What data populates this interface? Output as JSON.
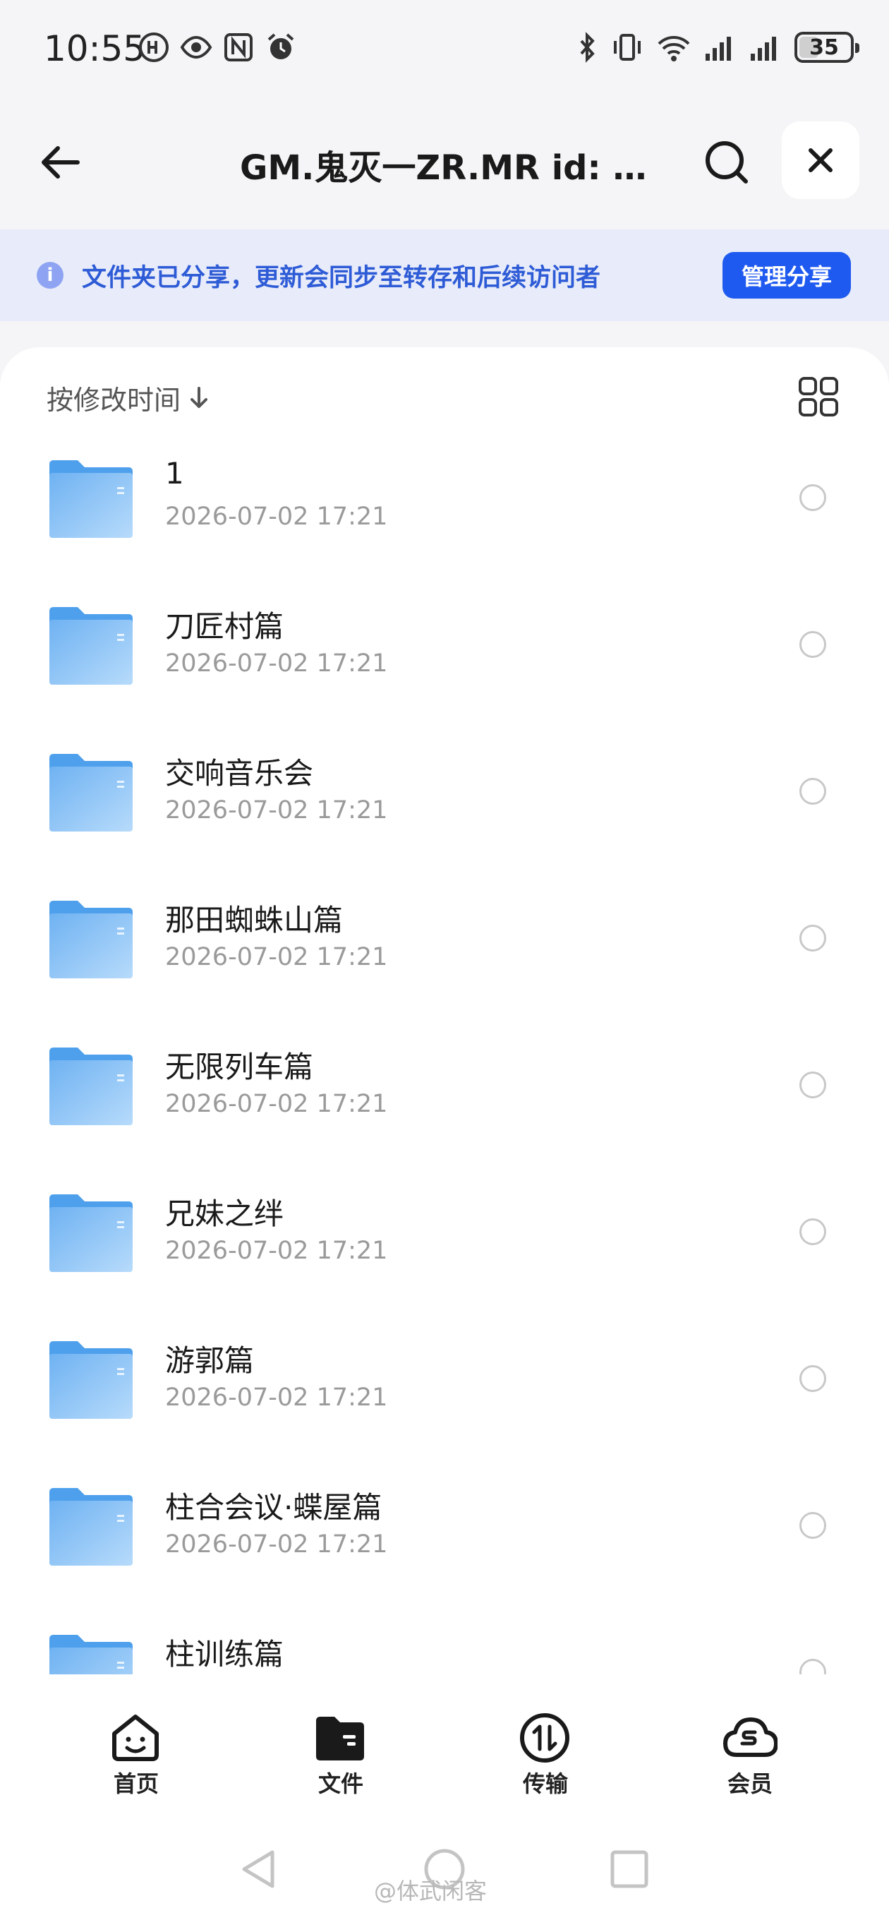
{
  "status_bar": {
    "time": "10:55",
    "battery": "35"
  },
  "header": {
    "title": "GM.鬼灭一ZR.MR id: …"
  },
  "share_banner": {
    "info_glyph": "i",
    "text": "文件夹已分享，更新会同步至转存和后续访问者",
    "manage_button": "管理分享"
  },
  "sort": {
    "label": "按修改时间"
  },
  "files": [
    {
      "name": "1",
      "date": "2026-07-02 17:21"
    },
    {
      "name": "刀匠村篇",
      "date": "2026-07-02 17:21"
    },
    {
      "name": "交响音乐会",
      "date": "2026-07-02 17:21"
    },
    {
      "name": "那田蜘蛛山篇",
      "date": "2026-07-02 17:21"
    },
    {
      "name": "无限列车篇",
      "date": "2026-07-02 17:21"
    },
    {
      "name": "兄妹之绊",
      "date": "2026-07-02 17:21"
    },
    {
      "name": "游郭篇",
      "date": "2026-07-02 17:21"
    },
    {
      "name": "柱合会议·蝶屋篇",
      "date": "2026-07-02 17:21"
    },
    {
      "name": "柱训练篇",
      "date": ""
    }
  ],
  "bottom_nav": [
    {
      "label": "首页",
      "icon": "home-face-icon"
    },
    {
      "label": "文件",
      "icon": "folder-icon"
    },
    {
      "label": "传输",
      "icon": "transfer-icon"
    },
    {
      "label": "会员",
      "icon": "vip-cloud-icon"
    }
  ],
  "watermark": "@体武闲客",
  "colors": {
    "accent": "#1f5af0",
    "banner_bg": "#e8ecfa",
    "banner_text": "#2e5bd6"
  }
}
